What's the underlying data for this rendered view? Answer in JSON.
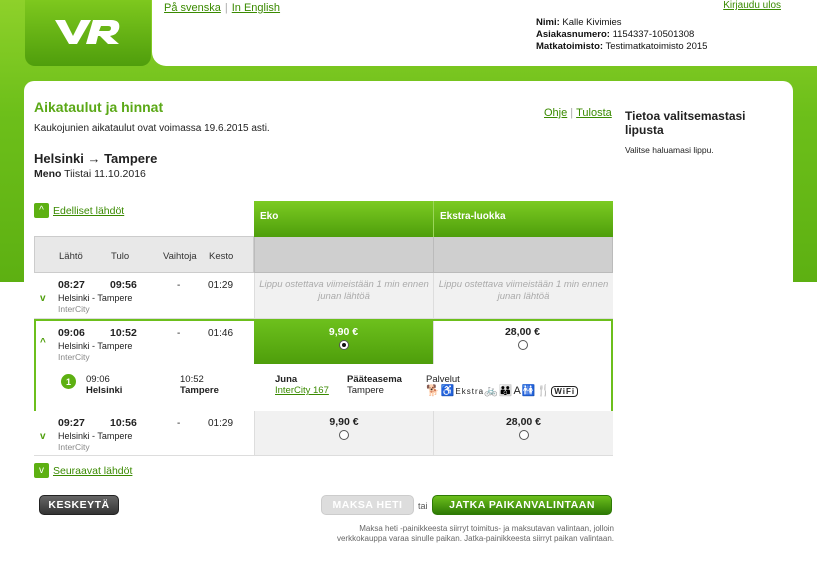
{
  "header": {
    "lang_sv": "På svenska",
    "lang_en": "In English",
    "logout": "Kirjaudu ulos",
    "user": {
      "name_label": "Nimi:",
      "name": "Kalle Kivimies",
      "customer_label": "Asiakasnumero:",
      "customer": "1154337-10501308",
      "office_label": "Matkatoimisto:",
      "office": "Testimatkatoimisto 2015"
    }
  },
  "main": {
    "title": "Aikataulut ja hinnat",
    "validity": "Kaukojunien aikataulut ovat voimassa 19.6.2015 asti.",
    "help": "Ohje",
    "print": "Tulosta",
    "route": "Helsinki → Tampere",
    "direction_label": "Meno",
    "direction_date": "Tiistai 11.10.2016",
    "prev_link": "Edelliset lähdöt",
    "next_link": "Seuraavat lähdöt"
  },
  "side": {
    "title": "Tietoa valitsemastasi lipusta",
    "text": "Valitse haluamasi lippu."
  },
  "table": {
    "headers": [
      "Lähtö",
      "Tulo",
      "Vaihtoja",
      "Kesto"
    ],
    "classes": [
      "Eko",
      "Ekstra-luokka"
    ],
    "unavailable": "Lippu ostettava viimeistään 1 min ennen junan lähtöä",
    "rows": [
      {
        "dep": "08:27",
        "arr": "09:56",
        "changes": "-",
        "dur": "01:29",
        "route": "Helsinki - Tampere",
        "op": "InterCity",
        "eko": "",
        "ekstra": ""
      },
      {
        "dep": "09:06",
        "arr": "10:52",
        "changes": "-",
        "dur": "01:46",
        "route": "Helsinki - Tampere",
        "op": "InterCity",
        "eko": "9,90 €",
        "ekstra": "28,00 €"
      },
      {
        "dep": "09:27",
        "arr": "10:56",
        "changes": "-",
        "dur": "01:29",
        "route": "Helsinki - Tampere",
        "op": "InterCity",
        "eko": "9,90 €",
        "ekstra": "28,00 €"
      }
    ]
  },
  "detail": {
    "num": "1",
    "dep_time": "09:06",
    "dep_station": "Helsinki",
    "arr_time": "10:52",
    "arr_station": "Tampere",
    "train_label": "Juna",
    "train": "InterCity 167",
    "dest_label": "Pääteasema",
    "dest": "Tampere",
    "services_label": "Palvelut",
    "services_text": "Ekstra"
  },
  "buttons": {
    "cancel": "KESKEYTÄ",
    "pay": "MAKSA HETI",
    "or": "tai",
    "continue": "JATKA PAIKANVALINTAAN"
  },
  "footnote": "Maksa heti -painikkeesta siirryt toimitus- ja maksutavan valintaan, jolloin verkkokauppa varaa sinulle paikan. Jatka-painikkeesta siirryt paikan valintaan.",
  "colors": {
    "accent": "#5db012",
    "dark": "#333333"
  }
}
